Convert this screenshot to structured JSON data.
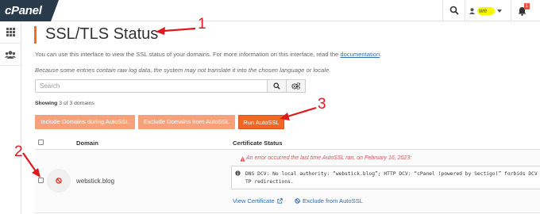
{
  "topbar": {
    "logo_text": "cPanel",
    "user_name": "we",
    "notification_count": "1"
  },
  "page": {
    "title": "SSL/TLS Status",
    "description_text": "You can use this interface to view the SSL status of your domains. For more information on this interface, read the",
    "documentation_link": "documentation",
    "description_end": ".",
    "locale_note": "Because some entries contain raw log data, the system may not translate it into the chosen language or locale."
  },
  "search": {
    "placeholder": "Search"
  },
  "showing": {
    "label": "Showing",
    "count": "3 of 3 domains"
  },
  "buttons": {
    "include": "Include Domains during AutoSSL",
    "exclude": "Exclude Domains from AutoSSL",
    "run": "Run AutoSSL"
  },
  "table": {
    "headers": {
      "domain": "Domain",
      "certificate_status": "Certificate Status"
    },
    "rows": [
      {
        "domain": "webstick.blog",
        "error_headline": "An error occurred the last time AutoSSL ran, on February 16, 2023:",
        "error_detail": "DNS DCV: No local authority: “webstick.blog”; HTTP DCV: “cPanel (powered by Sectigo)” forbids DCV HT\nTP redirections.",
        "view_certificate": "View Certificate",
        "exclude_link": "Exclude from AutoSSL"
      }
    ]
  },
  "annotations": {
    "one": "1",
    "two": "2",
    "three": "3",
    "color": "#e0191e"
  },
  "colors": {
    "accent": "#f26522",
    "accent_light": "#f5a27c",
    "link": "#2f6cb4",
    "error": "#d9534f",
    "header_bg": "#293a4a"
  }
}
